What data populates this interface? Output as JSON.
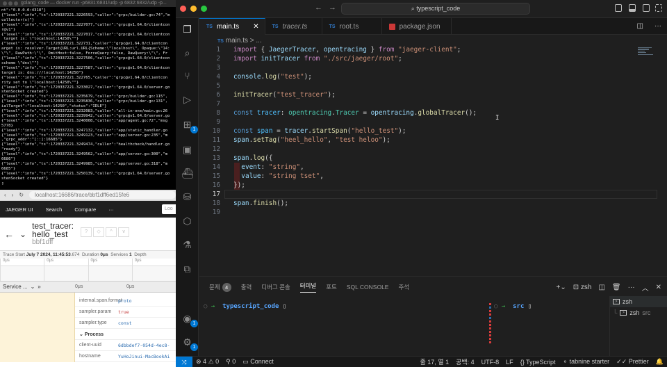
{
  "left_terminal": {
    "title": "golang_code — docker run -p6831:6831/udp -p 6832:6832/udp -p...",
    "lines": [
      "nt\":\"0.0.0.0:4318\"}",
      "{\"level\":\"info\",\"ts\":1720337221.3226593,\"caller\":\"grpc/builder.go:74\",\"m",
      "collector(s)\"}",
      "{\"level\":\"info\",\"ts\":1720337221.3227077,\"caller\":\"grpc@v1.64.0/clientcon",
      "r@v1\"}",
      "{\"level\":\"info\",\"ts\":1720337221.3227017,\"caller\":\"grpc@v1.64.0/clientcon",
      " target is: \\\"localhost:14250\\\"\"}",
      "{\"level\":\"info\",\"ts\":1720337221.322731,\"caller\":\"grpc@v1.64.0/clientcon",
      "arget is: resolver.Target{URL:url.URL{Scheme:\\\"localhost\\\", Opaque:\\\"14:",
      "\\\"\\\", RawPath:\\\"\\\", OmitHost:false, ForceQuery:false, RawQuery:\\\"\\\", Fr",
      "{\"level\":\"info\",\"ts\":1720337221.3227506,\"caller\":\"grpc@v1.64.0/clientcon",
      "scheme \\\"dns\\\"\"}",
      "{\"level\":\"info\",\"ts\":1720337221.3227587,\"caller\":\"grpc@v1.64.0/clientcon",
      "target is: dns:///localhost:14250\"}",
      "{\"level\":\"info\",\"ts\":1720337221.322765,\"caller\":\"grpc@v1.64.0/clientcon",
      "rity set to \\\"localhost:14250\\\"\"}",
      "{\"level\":\"info\",\"ts\":1720337221.3233027,\"caller\":\"grpc@v1.64.0/server.go",
      "stenSocket created\"}",
      "{\"level\":\"info\",\"ts\":1720337221.3235679,\"caller\":\"grpc/builder.go:115\",",
      "{\"level\":\"info\",\"ts\":1720337221.3235836,\"caller\":\"grpc/builder.go:131\",",
      "ialTarget\":\"localhost:14250\",\"status\":\"IDLE\"}",
      "{\"level\":\"info\",\"ts\":1720337221.3232083,\"caller\":\"all-in-one/main.go:26",
      "{\"level\":\"info\",\"ts\":1720337221.3239942,\"caller\":\"grpc@v1.64.0/server.go",
      "{\"level\":\"info\",\"ts\":1720337221.3240008,\"caller\":\"app/agent.go:72\",\"msg",
      "5778}",
      "{\"level\":\"info\",\"ts\":1720337221.3247132,\"caller\":\"app/static_handler.go",
      "{\"level\":\"info\",\"ts\":1720337221.3249123,\"caller\":\"app/server.go:235\",\"m",
      ",\"grpc_addr\":\"[::]:16685\"}",
      "{\"level\":\"info\",\"ts\":1720337221.3249474,\"caller\":\"healthcheck/handler.go",
      "\"ready\"}",
      "{\"level\":\"info\",\"ts\":1720337221.3249562,\"caller\":\"app/server.go:300\",\"m",
      "6686\"}",
      "{\"level\":\"info\",\"ts\":1720337221.3249985,\"caller\":\"app/server.go:318\",\"m",
      "6685\"}",
      "{\"level\":\"info\",\"ts\":1720337221.3250139,\"caller\":\"grpc@v1.64.0/server.go",
      "stenSocket created\"}",
      "▯"
    ]
  },
  "browser": {
    "url": "localhost:16686/trace/bbf1dff6ed15fe6",
    "nav": {
      "brand": "JAEGER UI",
      "search": "Search",
      "compare": "Compare",
      "more": "···",
      "find_placeholder": "Loo"
    },
    "trace": {
      "title_line1": "test_tracer:",
      "title_line2": "hello_test",
      "trace_id": "bbf1dff"
    },
    "meta": {
      "start_label": "Trace Start",
      "start_value": "July 7 2024, 11:45:53",
      "start_ms": ".674",
      "duration_label": "Duration",
      "duration_value": "0μs",
      "services_label": "Services",
      "services_value": "1",
      "depth_label": "Depth"
    },
    "ticks": [
      "0μs",
      "0μs",
      "0μs",
      "0μs"
    ],
    "service_header": "Service ...",
    "timeline_ticks": [
      "0μs",
      "0μs"
    ],
    "tags": [
      {
        "k": "internal.span.format",
        "v": "proto",
        "blue": true
      },
      {
        "k": "sampler.param",
        "v": "true",
        "blue": false
      },
      {
        "k": "sampler.type",
        "v": "const",
        "blue": true
      }
    ],
    "process_label": "Process",
    "process": [
      {
        "k": "client-uuid",
        "v": "6dbbdef7-054d-4ec8-",
        "blue": true
      },
      {
        "k": "hostname",
        "v": "YuHoJinui-MacBookAi",
        "blue": true
      }
    ]
  },
  "vscode": {
    "search_text": "typescript_code",
    "tabs": [
      {
        "label": "main.ts",
        "active": true,
        "italic": false,
        "icon": "TS"
      },
      {
        "label": "tracer.ts",
        "active": false,
        "italic": true,
        "icon": "TS"
      },
      {
        "label": "root.ts",
        "active": false,
        "italic": false,
        "icon": "TS"
      },
      {
        "label": "package.json",
        "active": false,
        "italic": false,
        "icon": "npm"
      }
    ],
    "breadcrumb": "main.ts",
    "breadcrumb_more": "...",
    "line_numbers": [
      "1",
      "2",
      "3",
      "4",
      "5",
      "6",
      "7",
      "8",
      "9",
      "10",
      "11",
      "12",
      "13",
      "14",
      "15",
      "16",
      "17",
      "18",
      "19"
    ],
    "current_line": 17,
    "panel": {
      "tabs": [
        "문제",
        "출력",
        "디버그 콘솔",
        "터미널",
        "포트",
        "SQL CONSOLE",
        "주석"
      ],
      "problem_count": "4",
      "active_tab": "터미널",
      "shell": "zsh",
      "term1_dir": "typescript_code",
      "term2_dir": "src",
      "term_list": [
        {
          "label": "zsh",
          "sub": ""
        },
        {
          "label": "zsh",
          "sub": "src"
        }
      ]
    },
    "status": {
      "errors": "4",
      "warnings": "0",
      "ports": "0",
      "connect": "Connect",
      "position": "줄 17, 열 1",
      "indent": "공백: 4",
      "encoding": "UTF-8",
      "eol": "LF",
      "language": "TypeScript",
      "tabnine": "tabnine starter",
      "prettier": "Prettier"
    },
    "accounts_badge": "1",
    "settings_badge": "1",
    "extensions_badge": "1"
  }
}
